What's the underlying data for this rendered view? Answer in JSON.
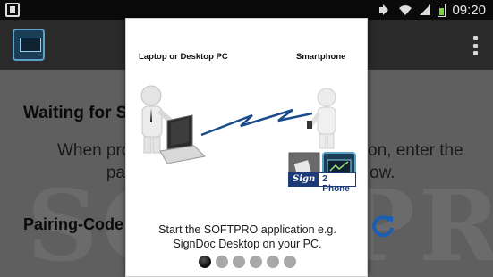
{
  "status_bar": {
    "time": "09:20",
    "icons": [
      "notification-icon",
      "mute-icon",
      "wifi-icon",
      "signal-icon",
      "battery-icon"
    ]
  },
  "app_bar": {
    "icon": "signdoc-app-icon",
    "menu_icon": "overflow-menu-icon"
  },
  "main": {
    "waiting_title": "Waiting for S",
    "instruction_left_line1": "When prom",
    "instruction_left_line2": "pa",
    "instruction_right_line1": "on, enter the",
    "instruction_right_line2": "ow.",
    "pairing_label": "Pairing-Code",
    "watermark": "SOFTPRO"
  },
  "dialog": {
    "left_label": "Laptop or Desktop PC",
    "right_label": "Smartphone",
    "badge_part1": "Sign",
    "badge_part2": "2 Phone",
    "caption_line1": "Start the SOFTPRO application e.g.",
    "caption_line2": "SignDoc Desktop on your PC.",
    "pager": {
      "total": 6,
      "active": 1
    }
  },
  "colors": {
    "status_bar": "#0a0a0a",
    "app_bar": "#2a2a2a",
    "background": "#5f5f5f",
    "dialog": "#ffffff",
    "accent_blue": "#1c3a78",
    "refresh_blue": "#1a5fb4"
  }
}
